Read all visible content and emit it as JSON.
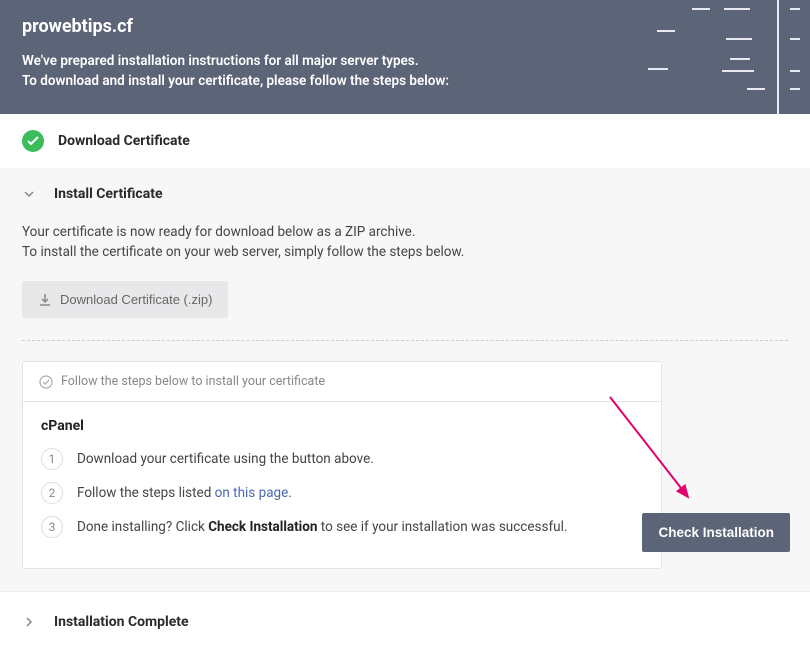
{
  "header": {
    "domain": "prowebtips.cf",
    "line1": "We've prepared installation instructions for all major server types.",
    "line2": "To download and install your certificate, please follow the steps below:"
  },
  "sections": {
    "download_title": "Download Certificate",
    "install_title": "Install Certificate",
    "complete_title": "Installation Complete"
  },
  "install": {
    "desc_line1": "Your certificate is now ready for download below as a ZIP archive.",
    "desc_line2": "To install the certificate on your web server, simply follow the steps below.",
    "download_button": "Download Certificate (.zip)",
    "steps_header": "Follow the steps below to install your certificate",
    "steps_title": "cPanel",
    "step1": "Download your certificate using the button above.",
    "step2_prefix": "Follow the steps listed ",
    "step2_link": "on this page",
    "step2_suffix": ".",
    "step3_prefix": "Done installing? Click ",
    "step3_bold": "Check Installation",
    "step3_suffix": " to see if your installation was successful."
  },
  "check_button": "Check Installation"
}
